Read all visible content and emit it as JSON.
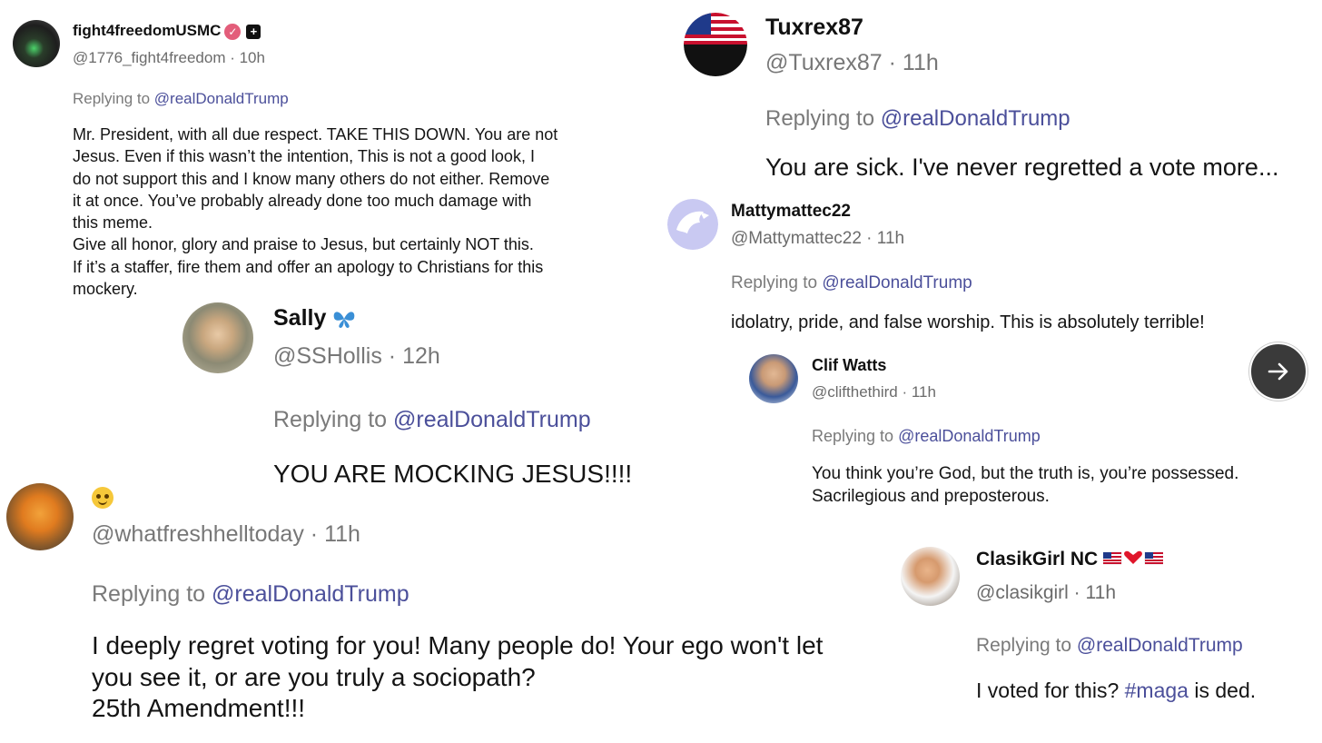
{
  "colors": {
    "mention": "#4b4f9a",
    "meta_text": "#6b6b6b",
    "verified_badge": "#e35d7a",
    "next_button": "#3a3a3a"
  },
  "replying_prefix": "Replying to ",
  "next_button_icon": "arrow-right-icon",
  "posts": [
    {
      "name": "fight4freedomUSMC",
      "handle": "@1776_fight4freedom",
      "time": "10h",
      "replying_to": "@realDonaldTrump",
      "badges": [
        "verified-badge-icon",
        "plus-badge-icon"
      ],
      "lines": [
        "Mr. President, with all due respect. TAKE THIS DOWN. You are not",
        "Jesus. Even if this wasn’t the intention, This is not a good look, I",
        "do not support this and I know many others do not either. Remove",
        "it at once. You’ve probably already done too much damage with",
        "this meme.",
        "Give all honor, glory and praise to Jesus, but certainly NOT this.",
        "If it’s a staffer, fire them and offer an apology  to Christians for this",
        "mockery."
      ]
    },
    {
      "name": "Sally",
      "name_emoji": "butterfly-icon",
      "handle": "@SSHollis",
      "time": "12h",
      "replying_to": "@realDonaldTrump",
      "lines": [
        "YOU ARE MOCKING JESUS!!!!"
      ]
    },
    {
      "name": "",
      "name_emoji": "smiling-face-icon",
      "handle": "@whatfreshhelltoday",
      "time": "11h",
      "replying_to": "@realDonaldTrump",
      "lines": [
        "I deeply regret voting for you! Many people do! Your ego won't let",
        "you see it, or are you truly a sociopath?",
        "25th Amendment!!!"
      ]
    },
    {
      "name": "Tuxrex87",
      "handle": "@Tuxrex87",
      "time": "11h",
      "replying_to": "@realDonaldTrump",
      "lines": [
        "You are sick. I've never regretted a vote more..."
      ]
    },
    {
      "name": "Mattymattec22",
      "handle": "@Mattymattec22",
      "time": "11h",
      "replying_to": "@realDonaldTrump",
      "lines": [
        "idolatry, pride, and false worship. This is absolutely terrible!"
      ]
    },
    {
      "name": "Clif Watts",
      "handle": "@clifthethird",
      "time": "11h",
      "replying_to": "@realDonaldTrump",
      "lines": [
        "You think you’re God, but the truth is, you’re possessed.",
        "Sacrilegious and preposterous."
      ]
    },
    {
      "name": "ClasikGirl NC",
      "name_emoji": "us-flag-heart-us-flag-icons",
      "handle": "@clasikgirl",
      "time": "11h",
      "replying_to": "@realDonaldTrump",
      "body_prefix": "I voted for this? ",
      "hashtag": "#maga",
      "body_suffix": " is ded."
    }
  ]
}
